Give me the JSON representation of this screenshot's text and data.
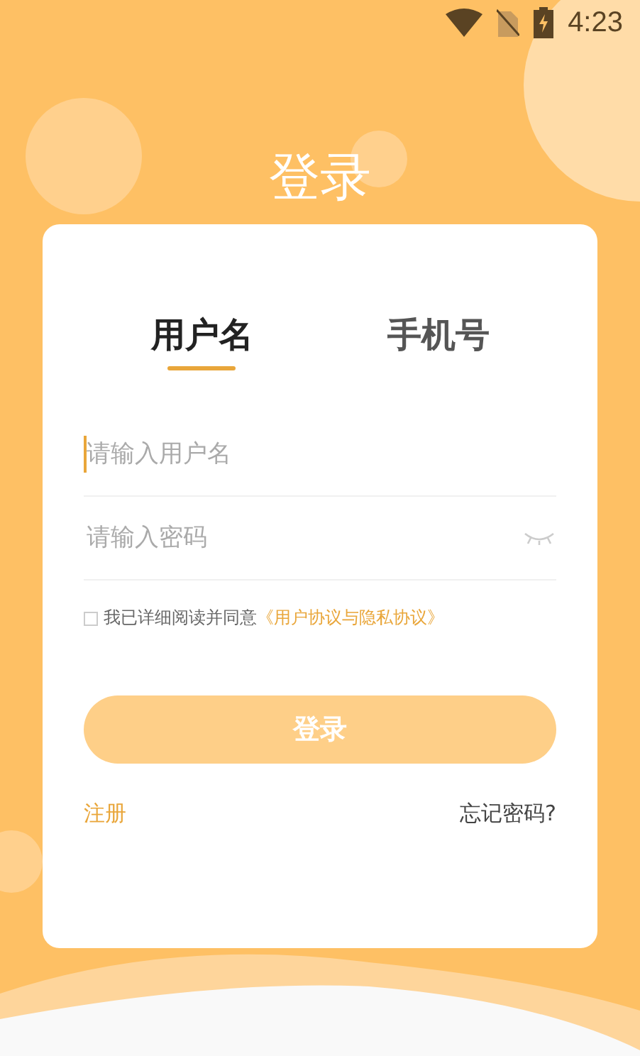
{
  "status_bar": {
    "time": "4:23"
  },
  "title": "登录",
  "tabs": [
    {
      "label": "用户名",
      "selected": true
    },
    {
      "label": "手机号",
      "selected": false
    }
  ],
  "fields": [
    {
      "kind": "text",
      "placeholder": "请输入用户名",
      "focused": true
    },
    {
      "kind": "password",
      "placeholder": "请输入密码",
      "focused": false
    }
  ],
  "agreement": {
    "checked": false,
    "text": "我已详细阅读并同意",
    "link": "《用户协议与隐私协议》"
  },
  "login_button": "登录",
  "register_link": "注册",
  "forgot_link": "忘记密码?"
}
